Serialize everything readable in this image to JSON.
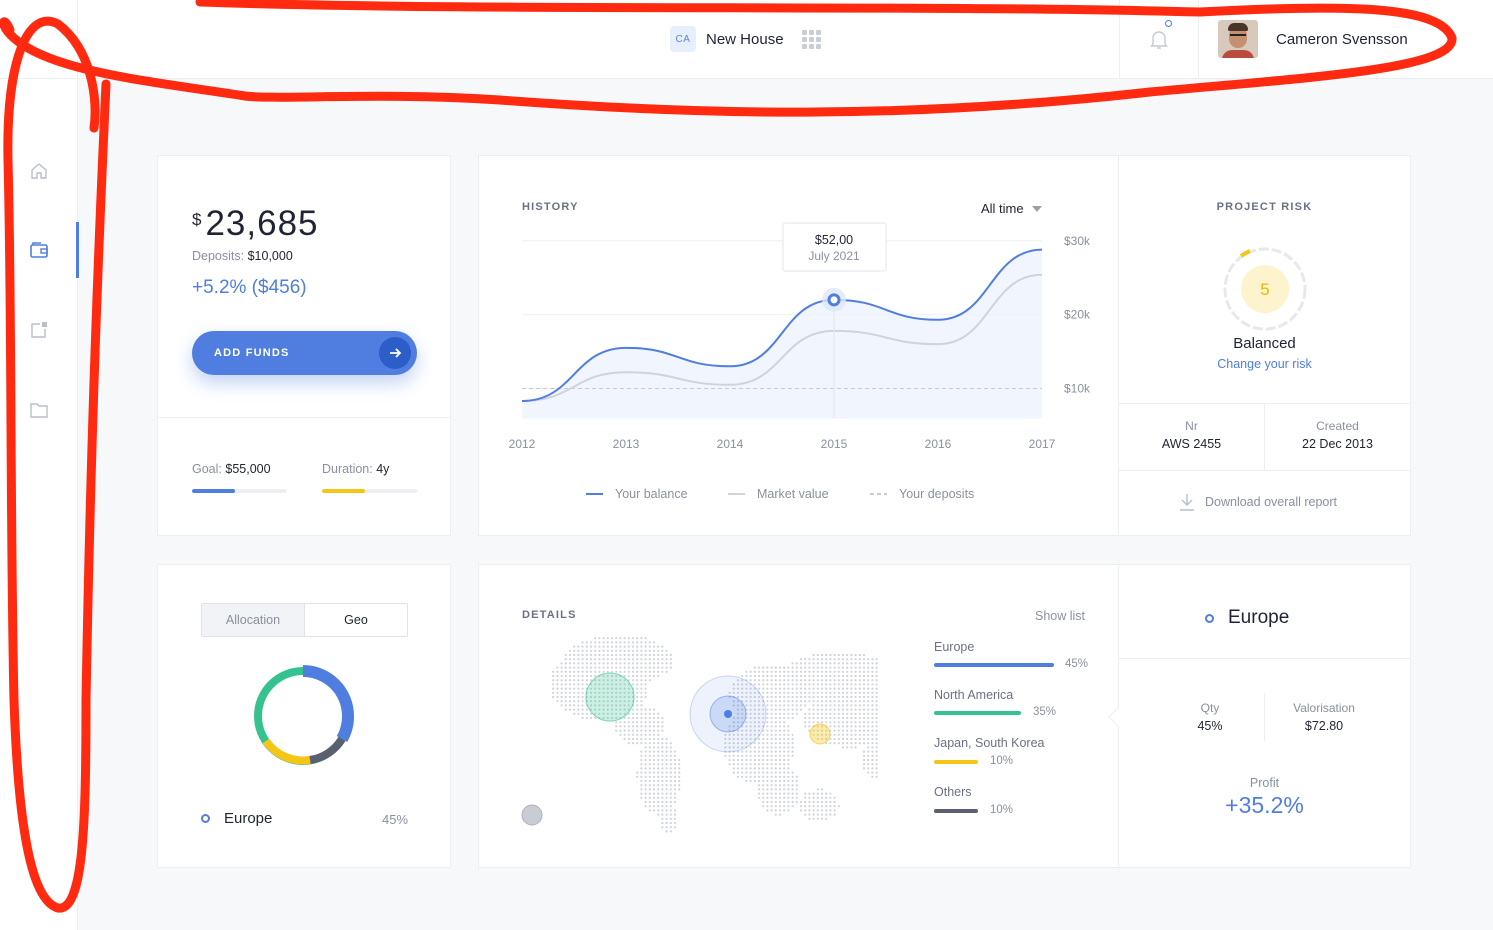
{
  "topbar": {
    "project_badge": "CA",
    "project_name": "New House",
    "user_name": "Cameron Svensson"
  },
  "sidebar": {
    "items": [
      "home",
      "portfolio",
      "reports",
      "folder"
    ],
    "active": "portfolio"
  },
  "balance": {
    "currency": "$",
    "amount": "23,685",
    "deposits_label": "Deposits:",
    "deposits_value": "$10,000",
    "change": "+5.2% ($456)",
    "add_funds_label": "ADD FUNDS",
    "goal_label": "Goal:",
    "goal_value": "$55,000",
    "goal_progress": 0.45,
    "duration_label": "Duration:",
    "duration_value": "4y",
    "duration_progress": 0.45
  },
  "history": {
    "title": "HISTORY",
    "range_label": "All time",
    "tooltip_value": "$52,00",
    "tooltip_date": "July 2021",
    "legend": [
      "Your balance",
      "Market value",
      "Your deposits"
    ]
  },
  "chart_data": {
    "type": "line",
    "x_ticks": [
      "2012",
      "2013",
      "2014",
      "2015",
      "2016",
      "2017"
    ],
    "y_ticks": [
      "$30k",
      "$20k",
      "$10k"
    ],
    "ylim": [
      6000,
      32000
    ],
    "series": [
      {
        "name": "Your balance",
        "x": [
          2012,
          2013,
          2014,
          2015,
          2016,
          2017
        ],
        "values": [
          8300,
          15500,
          13000,
          22000,
          19300,
          28800
        ]
      },
      {
        "name": "Market value",
        "x": [
          2012,
          2013,
          2014,
          2015,
          2016,
          2017
        ],
        "values": [
          8300,
          12200,
          10500,
          17800,
          16000,
          25400
        ]
      },
      {
        "name": "Your deposits",
        "x": [
          2012,
          2017
        ],
        "values": [
          10000,
          10000
        ]
      }
    ],
    "colors": {
      "balance": "#4f7ee0",
      "market": "#cfd3dd",
      "deposits": "#c5c9d2"
    }
  },
  "risk": {
    "title": "PROJECT RISK",
    "score": "5",
    "level": "Balanced",
    "change_link": "Change your risk",
    "nr_label": "Nr",
    "nr_value": "AWS 2455",
    "created_label": "Created",
    "created_value": "22 Dec 2013",
    "download_label": "Download overall report"
  },
  "allocation": {
    "tab_allocation": "Allocation",
    "tab_geo": "Geo",
    "region": "Europe",
    "region_pct": "45%"
  },
  "details": {
    "title": "DETAILS",
    "show_list": "Show list",
    "regions": [
      {
        "name": "Europe",
        "pct": "45%",
        "color": "#4f7ee0"
      },
      {
        "name": "North America",
        "pct": "35%",
        "color": "#35c28f"
      },
      {
        "name": "Japan, South Korea",
        "pct": "10%",
        "color": "#f5c518"
      },
      {
        "name": "Others",
        "pct": "10%",
        "color": "#5b6070"
      }
    ]
  },
  "region_panel": {
    "name": "Europe",
    "qty_label": "Qty",
    "qty_value": "45%",
    "val_label": "Valorisation",
    "val_value": "$72.80",
    "profit_label": "Profit",
    "profit_value": "+35.2%"
  }
}
